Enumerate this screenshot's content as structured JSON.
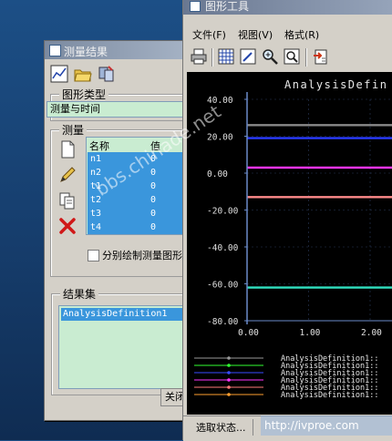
{
  "colors": {
    "desktop": "#1c4f86",
    "green_field": "#c9ecd1",
    "selection": "#3a96dc",
    "plot_bg": "#000000"
  },
  "measure_window": {
    "title": "测量结果",
    "toolbar_icons": [
      "graph-icon",
      "open-folder-icon",
      "tools-icon"
    ],
    "graph_type": {
      "label": "图形类型",
      "value": "测量与时间"
    },
    "measure": {
      "label": "测量",
      "side_buttons": [
        "new-icon",
        "edit-icon",
        "copy-icon",
        "delete-icon"
      ],
      "table": {
        "headers": [
          "名称",
          "值"
        ],
        "rows": [
          {
            "name": "n1",
            "value": "0"
          },
          {
            "name": "n2",
            "value": "0"
          },
          {
            "name": "t1",
            "value": "0"
          },
          {
            "name": "t2",
            "value": "0"
          },
          {
            "name": "t3",
            "value": "0"
          },
          {
            "name": "t4",
            "value": "0"
          }
        ]
      },
      "checkbox_label": "分别绘制测量图形"
    },
    "result_set": {
      "label": "结果集",
      "items": [
        "AnalysisDefinition1"
      ]
    },
    "close_label": "关闭"
  },
  "graph_window": {
    "title": "图形工具",
    "menus": [
      "文件(F)",
      "视图(V)",
      "格式(R)"
    ],
    "toolbar_icons": [
      "print-icon",
      "grid-icon",
      "edit-graph-icon",
      "zoom-in-icon",
      "zoom-fit-icon",
      "export-icon"
    ],
    "status": "选取状态..."
  },
  "chart_data": {
    "type": "line",
    "title": "AnalysisDefin",
    "ylabel": "",
    "xlabel": "",
    "yticks": [
      "40.00",
      "20.00",
      "0.00",
      "-20.00",
      "-40.00",
      "-60.00",
      "-80.00"
    ],
    "xticks": [
      "0.00",
      "1.00",
      "2.00"
    ],
    "ylim": [
      -80,
      40
    ],
    "xlim": [
      0,
      2.4
    ],
    "series": [
      {
        "color": "#8a8a8a",
        "values": [
          26,
          26
        ]
      },
      {
        "color": "#2a3cff",
        "values": [
          19,
          19
        ]
      },
      {
        "color": "#ff35ff",
        "values": [
          3,
          3
        ]
      },
      {
        "color": "#ff8a8a",
        "values": [
          -13,
          -13
        ]
      },
      {
        "color": "#30e0c0",
        "values": [
          -62,
          -62
        ]
      }
    ],
    "legend": [
      {
        "color": "#9a9a9a",
        "label": "AnalysisDefinition1::"
      },
      {
        "color": "#32ff32",
        "label": "AnalysisDefinition1::"
      },
      {
        "color": "#3a4cff",
        "label": "AnalysisDefinition1::"
      },
      {
        "color": "#ff35ff",
        "label": "AnalysisDefinition1::"
      },
      {
        "color": "#ff7a7a",
        "label": "AnalysisDefinition1::"
      },
      {
        "color": "#ffa030",
        "label": "AnalysisDefinition1::"
      }
    ]
  },
  "watermarks": [
    "bbs.chinade.net",
    "http://ivproe.com"
  ]
}
